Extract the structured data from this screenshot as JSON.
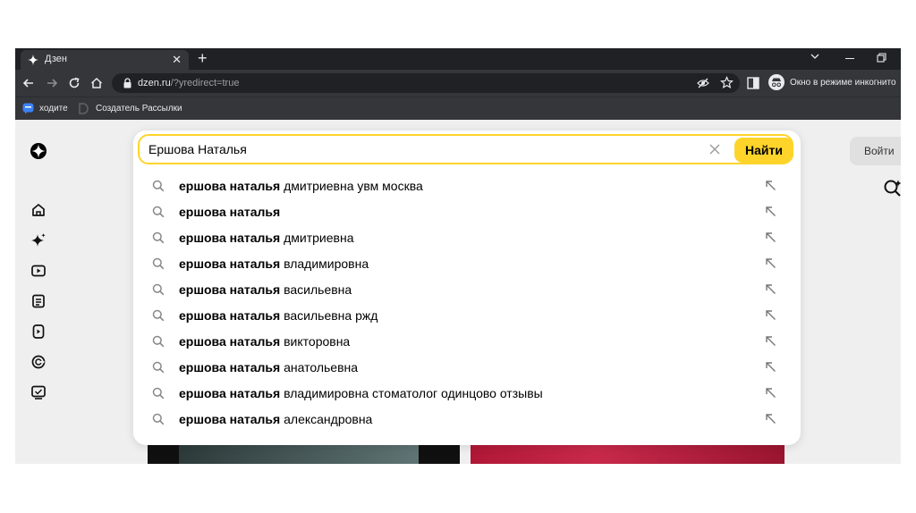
{
  "browser": {
    "tab_title": "Дзен",
    "url_host": "dzen.ru",
    "url_path": "/?yredirect=true",
    "incognito_label": "Окно в режиме инкогнито",
    "bookmarks": [
      "ходите",
      "Создатель Рассылки"
    ]
  },
  "header": {
    "login_label": "Войти"
  },
  "search": {
    "value": "Ершова Наталья",
    "find_label": "Найти",
    "bold_prefix": "ершова наталья",
    "suggestions": [
      " дмитриевна увм москва",
      "",
      " дмитриевна",
      " владимировна",
      " васильевна",
      " васильевна ржд",
      " викторовна",
      " анатольевна",
      " владимировна стоматолог одинцово отзывы",
      " александровна"
    ]
  },
  "colors": {
    "accent_yellow": "#fed42b",
    "chrome_dark": "#202124",
    "chrome_mid": "#35363a",
    "page_bg": "#efefef"
  },
  "icons": {
    "sidebar": [
      "home-icon",
      "sparkle-icon",
      "video-icon",
      "article-icon",
      "clips-icon",
      "channels-icon",
      "tv-icon"
    ]
  }
}
